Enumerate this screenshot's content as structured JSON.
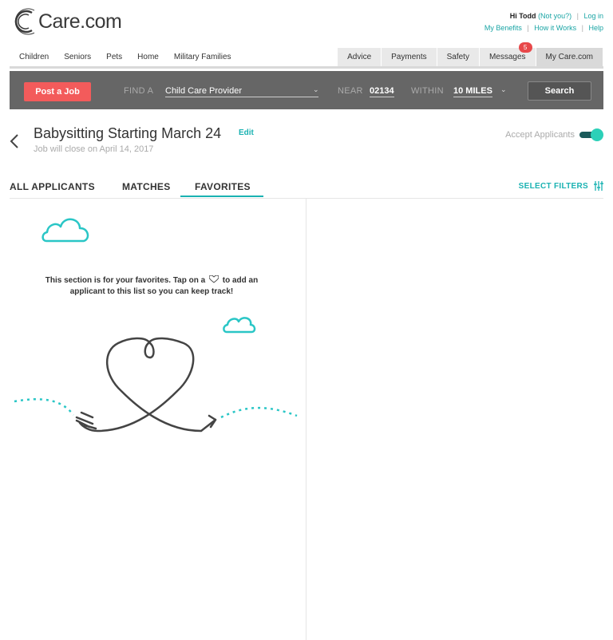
{
  "brand": {
    "logo_text": "Care.com"
  },
  "top_links": {
    "greeting": "Hi Todd",
    "not_you": "(Not you?)",
    "login": "Log in",
    "my_benefits": "My Benefits",
    "how_it_works": "How it Works",
    "help": "Help",
    "separator": "|"
  },
  "nav_left": [
    "Children",
    "Seniors",
    "Pets",
    "Home",
    "Military Families"
  ],
  "nav_right": {
    "advice": "Advice",
    "payments": "Payments",
    "safety": "Safety",
    "messages": "Messages",
    "messages_count": "5",
    "my_care": "My Care.com"
  },
  "search": {
    "post_job": "Post a Job",
    "find_label": "FIND A",
    "find_value": "Child Care Provider",
    "near_label": "NEAR",
    "near_value": "02134",
    "within_label": "WITHIN",
    "within_value": "10 MILES",
    "search_button": "Search"
  },
  "job": {
    "title": "Babysitting Starting March 24",
    "edit": "Edit",
    "subtitle": "Job will close on April 14, 2017",
    "accept_label": "Accept Applicants",
    "accept_on": true
  },
  "tabs": {
    "all": "ALL APPLICANTS",
    "matches": "MATCHES",
    "favorites": "FAVORITES",
    "active": "favorites",
    "select_filters": "SELECT FILTERS"
  },
  "favorites_empty": {
    "line1_a": "This section is for your favorites. Tap on a",
    "line1_b": "to add an",
    "line2": "applicant to this list so you can keep track!"
  },
  "colors": {
    "accent": "#1ab2b2",
    "post_job": "#f35b5b",
    "search_bar": "#666666",
    "badge": "#e8484a"
  }
}
